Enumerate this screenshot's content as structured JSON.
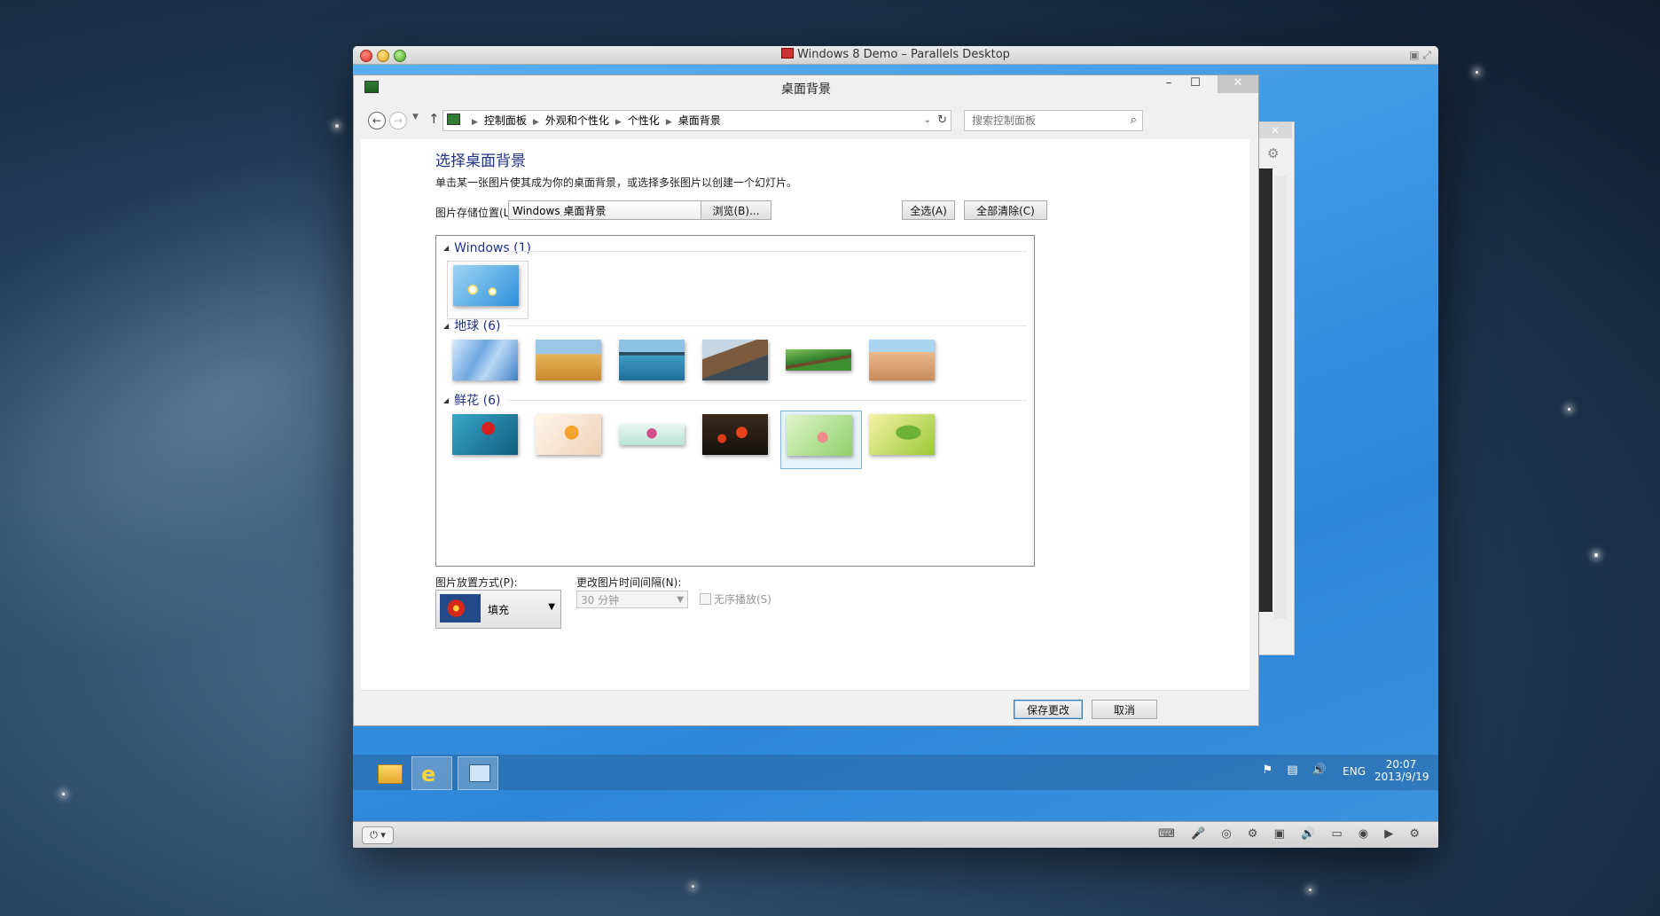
{
  "host": {
    "title": "Windows 8 Demo – Parallels Desktop"
  },
  "control_panel": {
    "title": "桌面背景",
    "breadcrumb": [
      "控制面板",
      "外观和个性化",
      "个性化",
      "桌面背景"
    ],
    "search_placeholder": "搜索控制面板",
    "heading": "选择桌面背景",
    "subtext": "单击某一张图片使其成为你的桌面背景，或选择多张图片以创建一个幻灯片。",
    "location_label": "图片存储位置(L):",
    "location_value": "Windows 桌面背景",
    "browse_button": "浏览(B)...",
    "select_all_button": "全选(A)",
    "clear_all_button": "全部清除(C)",
    "groups": [
      {
        "name": "Windows (1)",
        "count": 1,
        "selected_index": 0
      },
      {
        "name": "地球 (6)",
        "count": 6,
        "selected_index": -1
      },
      {
        "name": "鲜花 (6)",
        "count": 6,
        "selected_index": 4
      }
    ],
    "position_label": "图片放置方式(P):",
    "position_value": "填充",
    "interval_label": "更改图片时间间隔(N):",
    "interval_value": "30 分钟",
    "shuffle_label": "无序播放(S)",
    "save_button": "保存更改",
    "cancel_button": "取消"
  },
  "taskbar": {
    "lang": "ENG",
    "time": "20:07",
    "date": "2013/9/19"
  },
  "colors": {
    "heading_blue": "#1e3287",
    "desktop_blue": "#3c97e3",
    "selection_border": "#7eb4ea"
  }
}
